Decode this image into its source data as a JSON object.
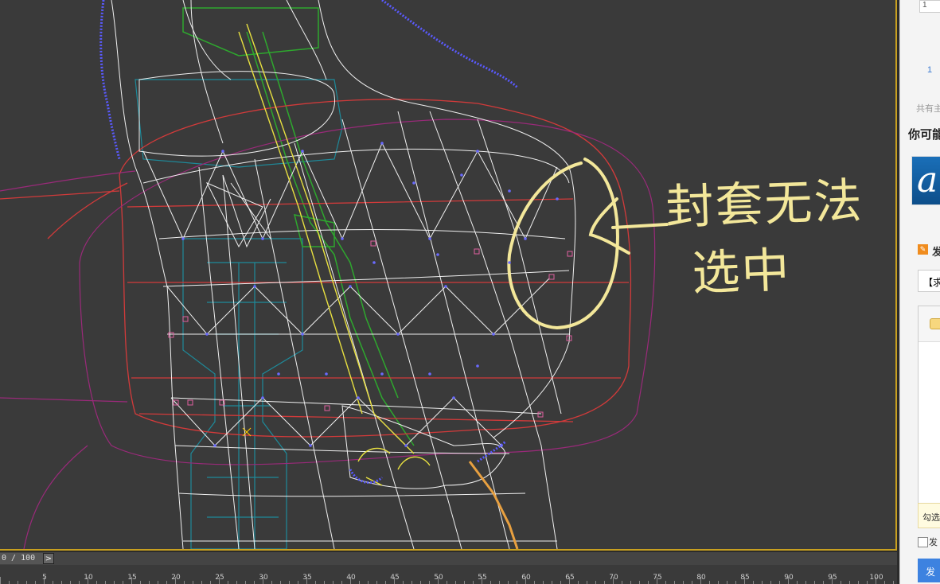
{
  "viewport": {
    "annotation_line1": "封套无法",
    "annotation_line2": "选中",
    "annotation_color": "#f3e79a"
  },
  "timeline": {
    "frame_value": "0 / 100",
    "next_frame_label": ">",
    "ruler_labels": [
      "5",
      "10",
      "15",
      "20",
      "25",
      "30",
      "35",
      "40",
      "45",
      "50",
      "55",
      "60",
      "65",
      "70",
      "75",
      "80",
      "85",
      "90",
      "95",
      "100"
    ]
  },
  "right_panel": {
    "box_text": "1",
    "page_number": "1",
    "total_text": "共有主",
    "header_text": "你可能",
    "logo_glyph": "a",
    "section_icon": "✎",
    "section_title": "发",
    "input_value": "【求",
    "tip_text": "勾选",
    "checkbox_label": "发",
    "submit_label": "发"
  },
  "colors": {
    "viewport_bg": "#3a3a3a",
    "wire_white": "#ffffff",
    "envelope_red": "#d23a3a",
    "envelope_purple": "#9a2a7a",
    "bone_yellow": "#e8e040",
    "teal": "#1e8a9a",
    "green": "#2ea82e",
    "vertex_blue": "#5a5aff",
    "frame_border": "#c8a020"
  }
}
